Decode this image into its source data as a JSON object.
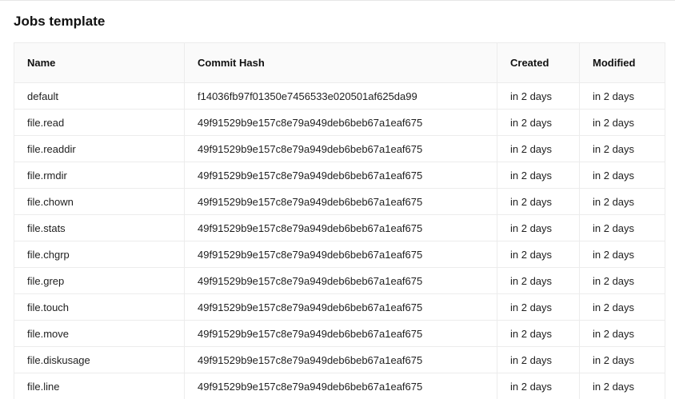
{
  "page": {
    "title": "Jobs template"
  },
  "table": {
    "columns": [
      "Name",
      "Commit Hash",
      "Created",
      "Modified"
    ],
    "rows": [
      {
        "name": "default",
        "hash": "f14036fb97f01350e7456533e020501af625da99",
        "created": "in 2 days",
        "modified": "in 2 days"
      },
      {
        "name": "file.read",
        "hash": "49f91529b9e157c8e79a949deb6beb67a1eaf675",
        "created": "in 2 days",
        "modified": "in 2 days"
      },
      {
        "name": "file.readdir",
        "hash": "49f91529b9e157c8e79a949deb6beb67a1eaf675",
        "created": "in 2 days",
        "modified": "in 2 days"
      },
      {
        "name": "file.rmdir",
        "hash": "49f91529b9e157c8e79a949deb6beb67a1eaf675",
        "created": "in 2 days",
        "modified": "in 2 days"
      },
      {
        "name": "file.chown",
        "hash": "49f91529b9e157c8e79a949deb6beb67a1eaf675",
        "created": "in 2 days",
        "modified": "in 2 days"
      },
      {
        "name": "file.stats",
        "hash": "49f91529b9e157c8e79a949deb6beb67a1eaf675",
        "created": "in 2 days",
        "modified": "in 2 days"
      },
      {
        "name": "file.chgrp",
        "hash": "49f91529b9e157c8e79a949deb6beb67a1eaf675",
        "created": "in 2 days",
        "modified": "in 2 days"
      },
      {
        "name": "file.grep",
        "hash": "49f91529b9e157c8e79a949deb6beb67a1eaf675",
        "created": "in 2 days",
        "modified": "in 2 days"
      },
      {
        "name": "file.touch",
        "hash": "49f91529b9e157c8e79a949deb6beb67a1eaf675",
        "created": "in 2 days",
        "modified": "in 2 days"
      },
      {
        "name": "file.move",
        "hash": "49f91529b9e157c8e79a949deb6beb67a1eaf675",
        "created": "in 2 days",
        "modified": "in 2 days"
      },
      {
        "name": "file.diskusage",
        "hash": "49f91529b9e157c8e79a949deb6beb67a1eaf675",
        "created": "in 2 days",
        "modified": "in 2 days"
      },
      {
        "name": "file.line",
        "hash": "49f91529b9e157c8e79a949deb6beb67a1eaf675",
        "created": "in 2 days",
        "modified": "in 2 days"
      }
    ]
  }
}
